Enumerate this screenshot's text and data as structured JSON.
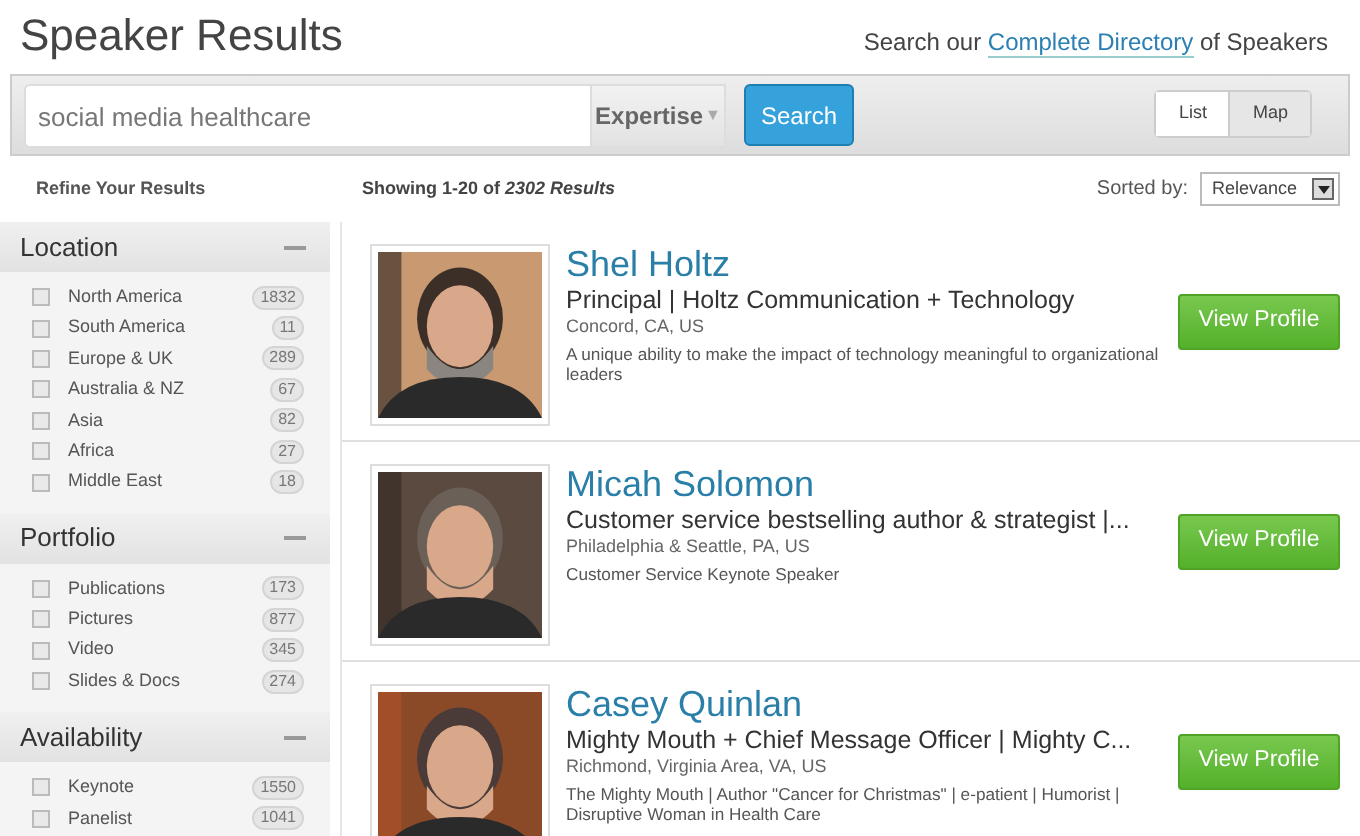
{
  "page_title": "Speaker Results",
  "directory_link": {
    "before": "Search our",
    "link": "Complete Directory",
    "after": "of Speakers"
  },
  "search": {
    "value": "social media healthcare",
    "filter": "Expertise",
    "filter_arrow": "▼",
    "button": "Search"
  },
  "view_toggle": [
    {
      "label": "List",
      "selected": true
    },
    {
      "label": "Map",
      "selected": false
    }
  ],
  "refine_label": "Refine Your Results",
  "results_summary": "Showing 1-20 of *2302 Results*",
  "sort": {
    "label": "Sorted by:",
    "value": "Relevance"
  },
  "filters": [
    {
      "title": "Location",
      "expanded": true,
      "options": [
        {
          "label": "North America",
          "count": "1832",
          "checked": false
        },
        {
          "label": "South America",
          "count": "11",
          "checked": false
        },
        {
          "label": "Europe & UK",
          "count": "289",
          "checked": false
        },
        {
          "label": "Australia & NZ",
          "count": "67",
          "checked": false
        },
        {
          "label": "Asia",
          "count": "82",
          "checked": false
        },
        {
          "label": "Africa",
          "count": "27",
          "checked": false
        },
        {
          "label": "Middle East",
          "count": "18",
          "checked": false
        }
      ]
    },
    {
      "title": "Portfolio",
      "expanded": true,
      "options": [
        {
          "label": "Publications",
          "count": "173",
          "checked": false
        },
        {
          "label": "Pictures",
          "count": "877",
          "checked": false
        },
        {
          "label": "Video",
          "count": "345",
          "checked": false
        },
        {
          "label": "Slides & Docs",
          "count": "274",
          "checked": false
        }
      ]
    },
    {
      "title": "Availability",
      "expanded": true,
      "options": [
        {
          "label": "Keynote",
          "count": "1550",
          "checked": false
        },
        {
          "label": "Panelist",
          "count": "1041",
          "checked": false
        }
      ]
    }
  ],
  "speakers": [
    {
      "name": "Shel Holtz",
      "title": "Principal | Holtz Communication + Technology",
      "location": "Concord, CA, US",
      "description": "A unique ability to make the impact of technology meaningful to organizational leaders",
      "button": "View Profile"
    },
    {
      "name": "Micah Solomon",
      "title": "Customer service bestselling author & strategist |...",
      "location": "Philadelphia & Seattle, PA, US",
      "description": "Customer Service Keynote Speaker",
      "button": "View Profile"
    },
    {
      "name": "Casey Quinlan",
      "title": "Mighty Mouth + Chief Message Officer | Mighty C...",
      "location": "Richmond, Virginia Area, VA, US",
      "description": "The Mighty Mouth | Author \"Cancer for Christmas\" | e-patient | Humorist | Disruptive Woman in Health Care",
      "button": "View Profile"
    }
  ]
}
